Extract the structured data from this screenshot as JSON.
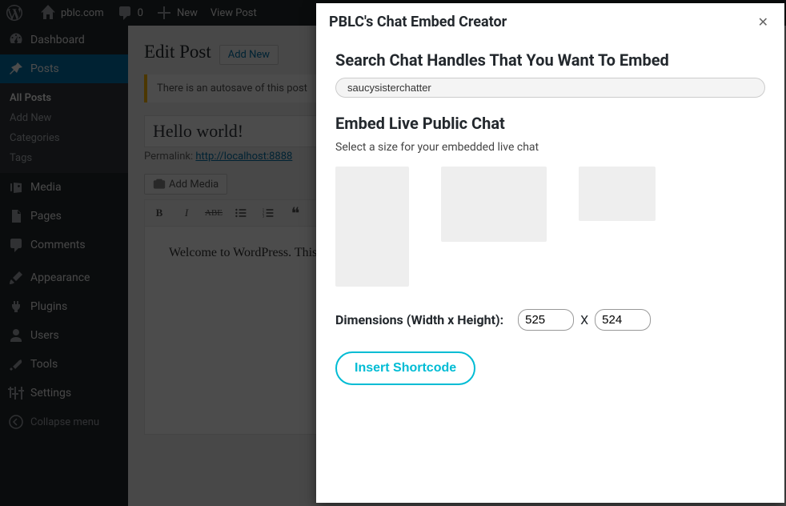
{
  "adminbar": {
    "site_name": "pblc.com",
    "comment_count": "0",
    "new_label": "New",
    "view_label": "View Post"
  },
  "menu": {
    "dashboard": "Dashboard",
    "posts": "Posts",
    "posts_sub": {
      "all": "All Posts",
      "add": "Add New",
      "categories": "Categories",
      "tags": "Tags"
    },
    "media": "Media",
    "pages": "Pages",
    "comments": "Comments",
    "appearance": "Appearance",
    "plugins": "Plugins",
    "users": "Users",
    "tools": "Tools",
    "settings": "Settings",
    "collapse": "Collapse menu"
  },
  "editor": {
    "heading": "Edit Post",
    "add_new": "Add New",
    "autosave_notice": "There is an autosave of this post",
    "title_value": "Hello world!",
    "permalink_label": "Permalink:",
    "permalink_url": "http://localhost:8888",
    "add_media": "Add Media",
    "body_text": "Welcome to WordPress. This is your first post. Edit or delete it, then start writing!"
  },
  "modal": {
    "title": "PBLC's Chat Embed Creator",
    "search_heading": "Search Chat Handles That You Want To Embed",
    "search_value": "saucysisterchatter",
    "embed_heading": "Embed Live Public Chat",
    "embed_sub": "Select a size for your embedded live chat",
    "dim_label": "Dimensions (Width x Height):",
    "width_value": "525",
    "height_value": "524",
    "x_label": "X",
    "insert_label": "Insert Shortcode"
  }
}
